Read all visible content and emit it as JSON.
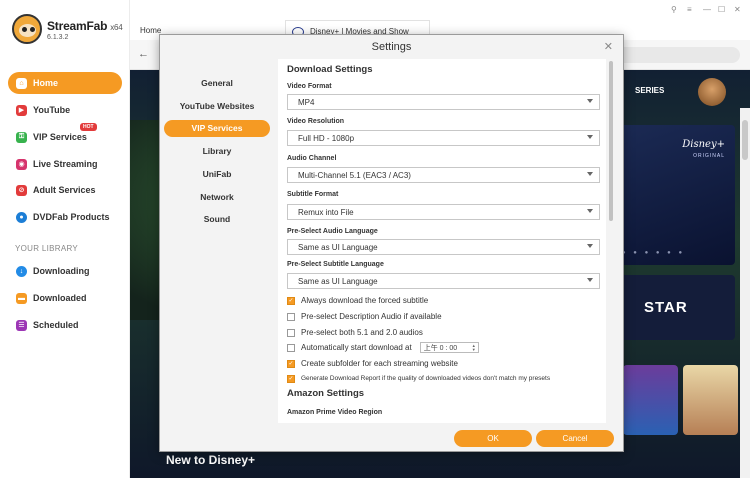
{
  "app": {
    "name": "StreamFab",
    "arch": "x64",
    "version": "6.1.3.2"
  },
  "sidebar": {
    "items": [
      {
        "label": "Home",
        "icon": "home-icon",
        "color": "#f59a23",
        "active": true
      },
      {
        "label": "YouTube",
        "icon": "youtube-icon",
        "color": "#e23b3b"
      },
      {
        "label": "VIP Services",
        "icon": "key-icon",
        "color": "#37b24d",
        "badge": "HOT"
      },
      {
        "label": "Live Streaming",
        "icon": "live-icon",
        "color": "#d6336c"
      },
      {
        "label": "Adult Services",
        "icon": "adult-icon",
        "color": "#e23b3b"
      },
      {
        "label": "DVDFab Products",
        "icon": "dvdfab-icon",
        "color": "#1c7ed6"
      }
    ],
    "library_title": "YOUR LIBRARY",
    "library": [
      {
        "label": "Downloading",
        "icon": "download-icon",
        "color": "#228be6"
      },
      {
        "label": "Downloaded",
        "icon": "folder-icon",
        "color": "#f59a23"
      },
      {
        "label": "Scheduled",
        "icon": "schedule-icon",
        "color": "#9c36b5"
      }
    ]
  },
  "browser": {
    "home_tab": "Home",
    "active_tab": "Disney+ | Movies and Show"
  },
  "content": {
    "series_label": "SERIES",
    "disney_plus": "Disney+",
    "original": "ORIGINAL",
    "star": "STAR",
    "new_row": "New to Disney+"
  },
  "settings": {
    "title": "Settings",
    "nav": [
      "General",
      "YouTube Websites",
      "VIP Services",
      "Library",
      "UniFab",
      "Network",
      "Sound"
    ],
    "active_nav": "VIP Services",
    "download_title": "Download Settings",
    "fields": [
      {
        "label": "Video Format",
        "value": "MP4"
      },
      {
        "label": "Video Resolution",
        "value": "Full HD - 1080p"
      },
      {
        "label": "Audio Channel",
        "value": "Multi-Channel 5.1 (EAC3 / AC3)"
      },
      {
        "label": "Subtitle Format",
        "value": "Remux into File"
      },
      {
        "label": "Pre-Select Audio Language",
        "value": "Same as UI Language"
      },
      {
        "label": "Pre-Select Subtitle Language",
        "value": "Same as UI Language"
      }
    ],
    "checks": [
      {
        "label": "Always download the forced subtitle",
        "checked": true
      },
      {
        "label": "Pre-select Description Audio if available",
        "checked": false
      },
      {
        "label": "Pre-select both 5.1 and 2.0 audios",
        "checked": false
      },
      {
        "label": "Automatically start download at",
        "checked": false
      },
      {
        "label": "Create subfolder for each streaming website",
        "checked": true
      },
      {
        "label": "Generate Download Report if the quality of downloaded videos don't match my presets",
        "checked": true
      }
    ],
    "time_value": "上午 0 : 00",
    "amazon_title": "Amazon Settings",
    "amazon_region_label": "Amazon Prime Video Region",
    "ok": "OK",
    "cancel": "Cancel"
  }
}
